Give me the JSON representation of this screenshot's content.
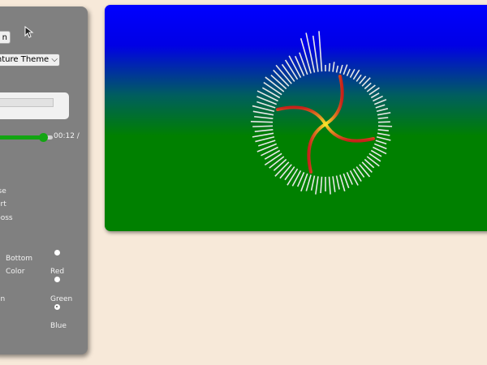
{
  "controls": {
    "button_label": "n",
    "theme_select_value": "enture Theme",
    "progress_fraction": 0.82,
    "time_text": "00:12 /",
    "effects": [
      "ise",
      "ert",
      "boss"
    ]
  },
  "radio_group": {
    "bottom_label": "Bottom",
    "color_label": "Color",
    "left_labels": [
      "on",
      "n"
    ],
    "options": [
      {
        "label": "Red",
        "checked": false
      },
      {
        "label": "Green",
        "checked": false
      },
      {
        "label": "Blue",
        "checked": true
      }
    ]
  },
  "visualizer": {
    "bar_color": "#e8e8e8",
    "gradient_top": "#0000ff",
    "gradient_bottom": "#008000",
    "spiral_colors": [
      "#f5e62a",
      "#c8201a"
    ]
  }
}
